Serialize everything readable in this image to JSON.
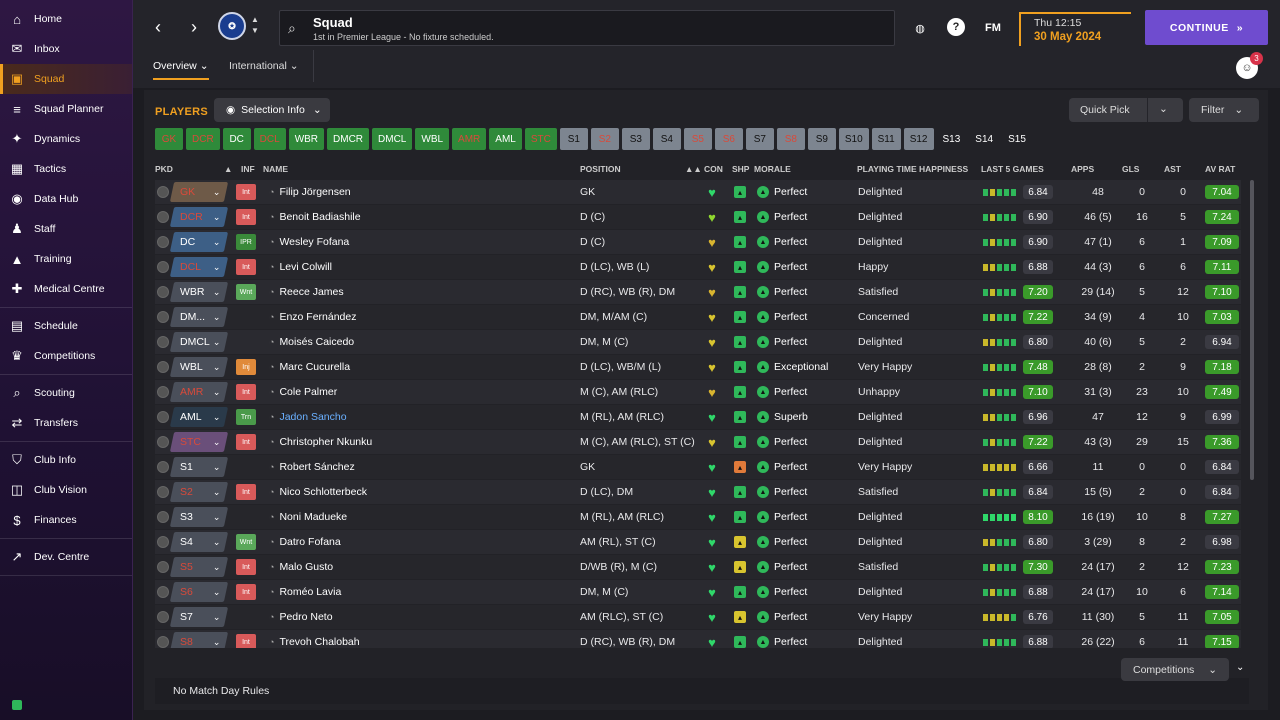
{
  "sidebar": {
    "groups": [
      [
        {
          "label": "Home",
          "icon": "⌂",
          "name": "home"
        },
        {
          "label": "Inbox",
          "icon": "✉",
          "name": "inbox"
        },
        {
          "label": "Squad",
          "icon": "▣",
          "name": "squad",
          "active": true
        },
        {
          "label": "Squad Planner",
          "icon": "≡",
          "name": "squad-planner"
        },
        {
          "label": "Dynamics",
          "icon": "✦",
          "name": "dynamics"
        },
        {
          "label": "Tactics",
          "icon": "▦",
          "name": "tactics"
        },
        {
          "label": "Data Hub",
          "icon": "◉",
          "name": "data-hub"
        },
        {
          "label": "Staff",
          "icon": "♟",
          "name": "staff"
        },
        {
          "label": "Training",
          "icon": "▲",
          "name": "training"
        },
        {
          "label": "Medical Centre",
          "icon": "✚",
          "name": "medical-centre"
        }
      ],
      [
        {
          "label": "Schedule",
          "icon": "▤",
          "name": "schedule"
        },
        {
          "label": "Competitions",
          "icon": "♛",
          "name": "competitions"
        }
      ],
      [
        {
          "label": "Scouting",
          "icon": "⌕",
          "name": "scouting"
        },
        {
          "label": "Transfers",
          "icon": "⇄",
          "name": "transfers"
        }
      ],
      [
        {
          "label": "Club Info",
          "icon": "⛉",
          "name": "club-info"
        },
        {
          "label": "Club Vision",
          "icon": "◫",
          "name": "club-vision"
        },
        {
          "label": "Finances",
          "icon": "$",
          "name": "finances"
        }
      ],
      [
        {
          "label": "Dev. Centre",
          "icon": "↗",
          "name": "dev-centre"
        }
      ]
    ]
  },
  "header": {
    "title": "Squad",
    "subtitle": "1st in Premier League - No fixture scheduled.",
    "date_time": "Thu 12:15",
    "date": "30 May 2024",
    "continue_label": "CONTINUE",
    "fm_label": "FM",
    "notification_count": "3",
    "tabs": [
      {
        "label": "Overview",
        "active": true
      },
      {
        "label": "International",
        "active": false
      }
    ]
  },
  "toolbar": {
    "players_title": "PLAYERS",
    "selection_info_label": "Selection Info",
    "quick_pick_label": "Quick Pick",
    "filter_label": "Filter"
  },
  "position_chips": [
    {
      "label": "GK",
      "style": "gr"
    },
    {
      "label": "DCR",
      "style": "gr"
    },
    {
      "label": "DC",
      "style": "g"
    },
    {
      "label": "DCL",
      "style": "gr"
    },
    {
      "label": "WBR",
      "style": "g"
    },
    {
      "label": "DMCR",
      "style": "g"
    },
    {
      "label": "DMCL",
      "style": "g"
    },
    {
      "label": "WBL",
      "style": "g"
    },
    {
      "label": "AMR",
      "style": "gr"
    },
    {
      "label": "AML",
      "style": "g"
    },
    {
      "label": "STC",
      "style": "gr"
    },
    {
      "label": "S1",
      "style": "s"
    },
    {
      "label": "S2",
      "style": "sr"
    },
    {
      "label": "S3",
      "style": "s"
    },
    {
      "label": "S4",
      "style": "s"
    },
    {
      "label": "S5",
      "style": "sr"
    },
    {
      "label": "S6",
      "style": "sr"
    },
    {
      "label": "S7",
      "style": "s"
    },
    {
      "label": "S8",
      "style": "sr"
    },
    {
      "label": "S9",
      "style": "s"
    },
    {
      "label": "S10",
      "style": "s"
    },
    {
      "label": "S11",
      "style": "s"
    },
    {
      "label": "S12",
      "style": "s"
    },
    {
      "label": "S13",
      "style": "b"
    },
    {
      "label": "S14",
      "style": "b"
    },
    {
      "label": "S15",
      "style": "b"
    }
  ],
  "columns": {
    "pkd": "PKD",
    "inf": "INF",
    "name": "NAME",
    "position": "POSITION",
    "con": "CON",
    "shp": "SHP",
    "morale": "MORALE",
    "happiness": "PLAYING TIME HAPPINESS",
    "last5": "LAST 5 GAMES",
    "apps": "APPS",
    "gls": "GLS",
    "ast": "AST",
    "avrat": "AV RAT"
  },
  "players": [
    {
      "slot": "GK",
      "slot_color": "#6e5a48",
      "slot_text": "#d94a3a",
      "inf": "Int",
      "name": "Filip Jörgensen",
      "position": "GK",
      "con": "#2fd86a",
      "shp": "#2fb85a",
      "morale": "Perfect",
      "happiness": "Delighted",
      "bars": [
        "#2fb85a",
        "#c9b82a",
        "#2fb85a",
        "#2fb85a",
        "#2fb85a"
      ],
      "last5": "6.84",
      "last5_hl": false,
      "apps": "48",
      "gls": "0",
      "ast": "0",
      "avrat": "7.04",
      "avrat_bg": "#3a9a2a"
    },
    {
      "slot": "DCR",
      "slot_color": "#3d5f86",
      "slot_text": "#d94a3a",
      "inf": "Int",
      "name": "Benoit Badiashile",
      "position": "D (C)",
      "con": "#8fd82f",
      "shp": "#2fb85a",
      "morale": "Perfect",
      "happiness": "Delighted",
      "bars": [
        "#2fb85a",
        "#c9b82a",
        "#2fb85a",
        "#2fb85a",
        "#2fb85a"
      ],
      "last5": "6.90",
      "last5_hl": false,
      "apps": "46 (5)",
      "gls": "16",
      "ast": "5",
      "avrat": "7.24",
      "avrat_bg": "#3a9a2a"
    },
    {
      "slot": "DC",
      "slot_color": "#3d5f86",
      "slot_text": "#fff",
      "inf": "IPR",
      "name": "Wesley Fofana",
      "position": "D (C)",
      "con": "#d8b42f",
      "shp": "#2fb85a",
      "morale": "Perfect",
      "happiness": "Delighted",
      "bars": [
        "#2fb85a",
        "#c9b82a",
        "#2fb85a",
        "#2fb85a",
        "#2fb85a"
      ],
      "last5": "6.90",
      "last5_hl": false,
      "apps": "47 (1)",
      "gls": "6",
      "ast": "1",
      "avrat": "7.09",
      "avrat_bg": "#3a9a2a"
    },
    {
      "slot": "DCL",
      "slot_color": "#3d5f86",
      "slot_text": "#d94a3a",
      "inf": "Int",
      "name": "Levi Colwill",
      "position": "D (LC), WB (L)",
      "con": "#d8c42f",
      "shp": "#2fb85a",
      "morale": "Perfect",
      "happiness": "Happy",
      "bars": [
        "#c9b82a",
        "#c9b82a",
        "#2fb85a",
        "#2fb85a",
        "#2fb85a"
      ],
      "last5": "6.88",
      "last5_hl": false,
      "apps": "44 (3)",
      "gls": "6",
      "ast": "6",
      "avrat": "7.11",
      "avrat_bg": "#3a9a2a"
    },
    {
      "slot": "WBR",
      "slot_color": "#4a4f5a",
      "slot_text": "#fff",
      "inf": "Wnt",
      "name": "Reece James",
      "position": "D (RC), WB (R), DM",
      "con": "#d8b42f",
      "shp": "#2fb85a",
      "morale": "Perfect",
      "happiness": "Satisfied",
      "bars": [
        "#2fb85a",
        "#c9b82a",
        "#2fb85a",
        "#2fb85a",
        "#2fb85a"
      ],
      "last5": "7.20",
      "last5_hl": true,
      "apps": "29 (14)",
      "gls": "5",
      "ast": "12",
      "avrat": "7.10",
      "avrat_bg": "#3a9a2a"
    },
    {
      "slot": "DM...",
      "slot_color": "#4a4f5a",
      "slot_text": "#fff",
      "inf": "",
      "name": "Enzo Fernández",
      "position": "DM, M/AM (C)",
      "con": "#d8c42f",
      "shp": "#2fb85a",
      "morale": "Perfect",
      "happiness": "Concerned",
      "bars": [
        "#2fb85a",
        "#c9b82a",
        "#2fb85a",
        "#2fb85a",
        "#2fb85a"
      ],
      "last5": "7.22",
      "last5_hl": true,
      "apps": "34 (9)",
      "gls": "4",
      "ast": "10",
      "avrat": "7.03",
      "avrat_bg": "#3a9a2a"
    },
    {
      "slot": "DMCL",
      "slot_color": "#4a4f5a",
      "slot_text": "#fff",
      "inf": "",
      "name": "Moisés Caicedo",
      "position": "DM, M (C)",
      "con": "#d8c42f",
      "shp": "#2fb85a",
      "morale": "Perfect",
      "happiness": "Delighted",
      "bars": [
        "#c9b82a",
        "#c9b82a",
        "#2fb85a",
        "#2fb85a",
        "#2fb85a"
      ],
      "last5": "6.80",
      "last5_hl": false,
      "apps": "40 (6)",
      "gls": "5",
      "ast": "2",
      "avrat": "6.94",
      "avrat_bg": "#3a3a42"
    },
    {
      "slot": "WBL",
      "slot_color": "#4a4f5a",
      "slot_text": "#fff",
      "inf": "Inj",
      "name": "Marc Cucurella",
      "position": "D (LC), WB/M (L)",
      "con": "#d8c42f",
      "shp": "#2fb85a",
      "morale": "Exceptional",
      "happiness": "Very Happy",
      "bars": [
        "#2fb85a",
        "#c9b82a",
        "#2fb85a",
        "#2fb85a",
        "#2fb85a"
      ],
      "last5": "7.48",
      "last5_hl": true,
      "apps": "28 (8)",
      "gls": "2",
      "ast": "9",
      "avrat": "7.18",
      "avrat_bg": "#3a9a2a"
    },
    {
      "slot": "AMR",
      "slot_color": "#4a4f5a",
      "slot_text": "#d94a3a",
      "inf": "Int",
      "name": "Cole Palmer",
      "position": "M (C), AM (RLC)",
      "con": "#d8b42f",
      "shp": "#2fb85a",
      "morale": "Perfect",
      "happiness": "Unhappy",
      "bars": [
        "#2fb85a",
        "#c9b82a",
        "#2fb85a",
        "#2fb85a",
        "#2fb85a"
      ],
      "last5": "7.10",
      "last5_hl": true,
      "apps": "31 (3)",
      "gls": "23",
      "ast": "10",
      "avrat": "7.49",
      "avrat_bg": "#3a9a2a"
    },
    {
      "slot": "AML",
      "slot_color": "#2a3a4a",
      "slot_text": "#fff",
      "inf": "Trn",
      "name": "Jadon Sancho",
      "position": "M (RL), AM (RLC)",
      "con": "#2fd86a",
      "shp": "#2fb85a",
      "morale": "Superb",
      "happiness": "Delighted",
      "bars": [
        "#c9b82a",
        "#c9b82a",
        "#2fb85a",
        "#2fb85a",
        "#2fb85a"
      ],
      "last5": "6.96",
      "last5_hl": false,
      "apps": "47",
      "gls": "12",
      "ast": "9",
      "avrat": "6.99",
      "avrat_bg": "#3a3a42",
      "name_color": "#6ab0ff"
    },
    {
      "slot": "STC",
      "slot_color": "#6a4f7a",
      "slot_text": "#d94a3a",
      "inf": "Int",
      "name": "Christopher Nkunku",
      "position": "M (C), AM (RLC), ST (C)",
      "con": "#d8c42f",
      "shp": "#2fb85a",
      "morale": "Perfect",
      "happiness": "Delighted",
      "bars": [
        "#2fb85a",
        "#c9b82a",
        "#2fb85a",
        "#2fb85a",
        "#2fb85a"
      ],
      "last5": "7.22",
      "last5_hl": true,
      "apps": "43 (3)",
      "gls": "29",
      "ast": "15",
      "avrat": "7.36",
      "avrat_bg": "#3a9a2a"
    },
    {
      "slot": "S1",
      "slot_color": "#4a4f5a",
      "slot_text": "#fff",
      "inf": "",
      "name": "Robert Sánchez",
      "position": "GK",
      "con": "#2fd86a",
      "shp": "#e07a3a",
      "morale": "Perfect",
      "happiness": "Very Happy",
      "bars": [
        "#c9b82a",
        "#c9b82a",
        "#c9b82a",
        "#c9b82a",
        "#c9b82a"
      ],
      "last5": "6.66",
      "last5_hl": false,
      "apps": "11",
      "gls": "0",
      "ast": "0",
      "avrat": "6.84",
      "avrat_bg": "#3a3a42"
    },
    {
      "slot": "S2",
      "slot_color": "#4a4f5a",
      "slot_text": "#d94a3a",
      "inf": "Int",
      "name": "Nico Schlotterbeck",
      "position": "D (LC), DM",
      "con": "#2fd86a",
      "shp": "#2fb85a",
      "morale": "Perfect",
      "happiness": "Satisfied",
      "bars": [
        "#2fb85a",
        "#c9b82a",
        "#2fb85a",
        "#2fb85a",
        "#2fb85a"
      ],
      "last5": "6.84",
      "last5_hl": false,
      "apps": "15 (5)",
      "gls": "2",
      "ast": "0",
      "avrat": "6.84",
      "avrat_bg": "#3a3a42"
    },
    {
      "slot": "S3",
      "slot_color": "#4a4f5a",
      "slot_text": "#fff",
      "inf": "",
      "name": "Noni Madueke",
      "position": "M (RL), AM (RLC)",
      "con": "#2fd86a",
      "shp": "#2fb85a",
      "morale": "Perfect",
      "happiness": "Delighted",
      "bars": [
        "#2fd86a",
        "#2fd86a",
        "#2fd86a",
        "#2fd86a",
        "#2fd86a"
      ],
      "last5": "8.10",
      "last5_hl": true,
      "apps": "16 (19)",
      "gls": "10",
      "ast": "8",
      "avrat": "7.27",
      "avrat_bg": "#3a9a2a"
    },
    {
      "slot": "S4",
      "slot_color": "#4a4f5a",
      "slot_text": "#fff",
      "inf": "Wnt",
      "name": "Datro Fofana",
      "position": "AM (RL), ST (C)",
      "con": "#2fd86a",
      "shp": "#d8c42f",
      "morale": "Perfect",
      "happiness": "Delighted",
      "bars": [
        "#c9b82a",
        "#c9b82a",
        "#2fb85a",
        "#2fb85a",
        "#2fb85a"
      ],
      "last5": "6.80",
      "last5_hl": false,
      "apps": "3 (29)",
      "gls": "8",
      "ast": "2",
      "avrat": "6.98",
      "avrat_bg": "#3a3a42"
    },
    {
      "slot": "S5",
      "slot_color": "#4a4f5a",
      "slot_text": "#d94a3a",
      "inf": "Int",
      "name": "Malo Gusto",
      "position": "D/WB (R), M (C)",
      "con": "#2fd86a",
      "shp": "#d8c42f",
      "morale": "Perfect",
      "happiness": "Satisfied",
      "bars": [
        "#2fb85a",
        "#c9b82a",
        "#2fb85a",
        "#2fb85a",
        "#2fb85a"
      ],
      "last5": "7.30",
      "last5_hl": true,
      "apps": "24 (17)",
      "gls": "2",
      "ast": "12",
      "avrat": "7.23",
      "avrat_bg": "#3a9a2a"
    },
    {
      "slot": "S6",
      "slot_color": "#4a4f5a",
      "slot_text": "#d94a3a",
      "inf": "Int",
      "name": "Roméo Lavia",
      "position": "DM, M (C)",
      "con": "#2fd86a",
      "shp": "#2fb85a",
      "morale": "Perfect",
      "happiness": "Delighted",
      "bars": [
        "#2fb85a",
        "#c9b82a",
        "#2fb85a",
        "#2fb85a",
        "#2fb85a"
      ],
      "last5": "6.88",
      "last5_hl": false,
      "apps": "24 (17)",
      "gls": "10",
      "ast": "6",
      "avrat": "7.14",
      "avrat_bg": "#3a9a2a"
    },
    {
      "slot": "S7",
      "slot_color": "#4a4f5a",
      "slot_text": "#fff",
      "inf": "",
      "name": "Pedro Neto",
      "position": "AM (RLC), ST (C)",
      "con": "#2fd86a",
      "shp": "#d8c42f",
      "morale": "Perfect",
      "happiness": "Very Happy",
      "bars": [
        "#c9b82a",
        "#c9b82a",
        "#c9b82a",
        "#c9b82a",
        "#2fb85a"
      ],
      "last5": "6.76",
      "last5_hl": false,
      "apps": "11 (30)",
      "gls": "5",
      "ast": "11",
      "avrat": "7.05",
      "avrat_bg": "#3a9a2a"
    },
    {
      "slot": "S8",
      "slot_color": "#4a4f5a",
      "slot_text": "#d94a3a",
      "inf": "Int",
      "name": "Trevoh Chalobah",
      "position": "D (RC), WB (R), DM",
      "con": "#2fd86a",
      "shp": "#2fb85a",
      "morale": "Perfect",
      "happiness": "Delighted",
      "bars": [
        "#2fb85a",
        "#c9b82a",
        "#2fb85a",
        "#2fb85a",
        "#2fb85a"
      ],
      "last5": "6.88",
      "last5_hl": false,
      "apps": "26 (22)",
      "gls": "6",
      "ast": "11",
      "avrat": "7.15",
      "avrat_bg": "#3a9a2a"
    }
  ],
  "footer": {
    "competitions_label": "Competitions",
    "match_rules": "No Match Day Rules"
  },
  "colors": {
    "accent": "#f0a020",
    "continue": "#6f4ccf",
    "green": "#2fb85a"
  }
}
